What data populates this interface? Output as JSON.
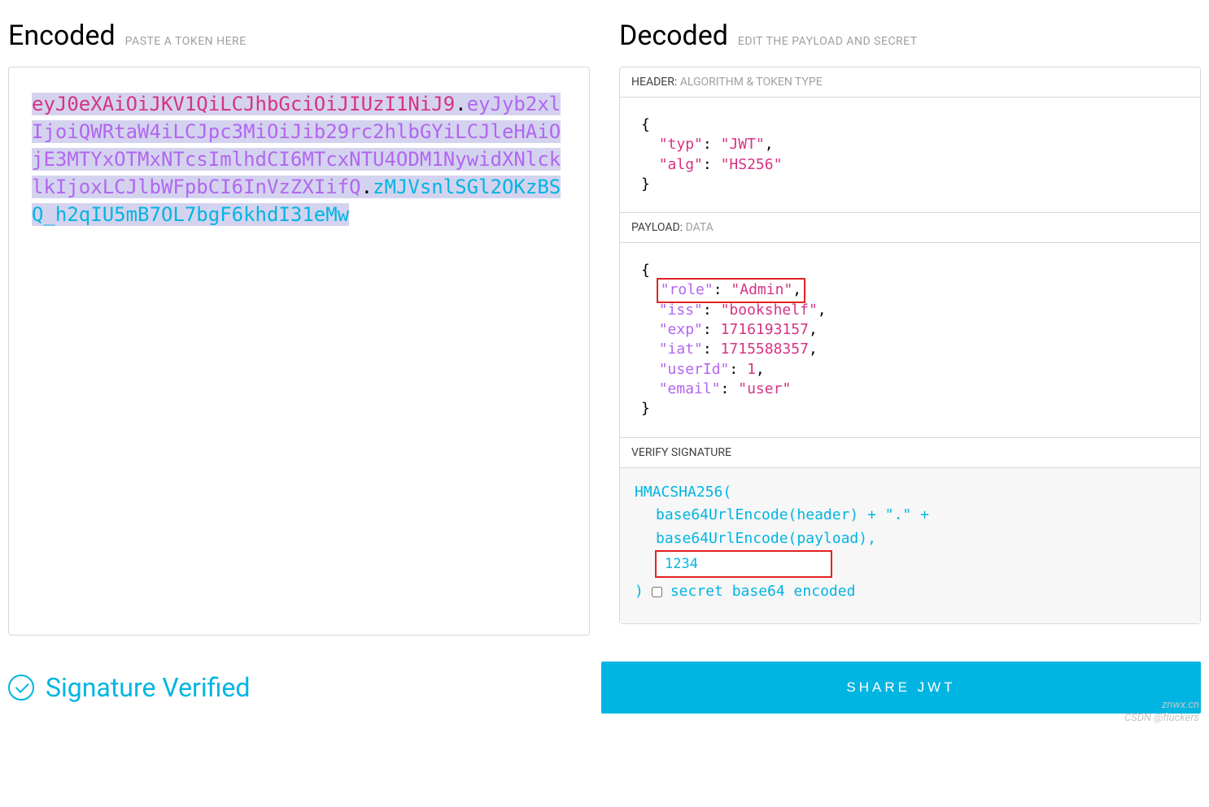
{
  "encoded": {
    "title": "Encoded",
    "hint": "PASTE A TOKEN HERE",
    "header": "eyJ0eXAiOiJKV1QiLCJhbGciOiJIUzI1NiJ9",
    "payload": "eyJyb2xlIjoiQWRtaW4iLCJpc3MiOiJib29rc2hlbGYiLCJleHAiOjE3MTYxOTMxNTcsImlhdCI6MTcxNTU4ODM1NywidXNlcklkIjoxLCJlbWFpbCI6InVzZXIifQ",
    "signature": "zMJVsnlSGl2OKzBSQ_h2qIU5mB7OL7bgF6khdI31eMw"
  },
  "decoded": {
    "title": "Decoded",
    "hint": "EDIT THE PAYLOAD AND SECRET",
    "header_section": {
      "label": "HEADER:",
      "sub": "ALGORITHM & TOKEN TYPE"
    },
    "header_json": {
      "typ": "JWT",
      "alg": "HS256"
    },
    "payload_section": {
      "label": "PAYLOAD:",
      "sub": "DATA"
    },
    "payload_json": {
      "role": "Admin",
      "iss": "bookshelf",
      "exp": 1716193157,
      "iat": 1715588357,
      "userId": 1,
      "email": "user"
    },
    "verify_section": {
      "label": "VERIFY SIGNATURE"
    },
    "signature": {
      "fn": "HMACSHA256(",
      "line1": "base64UrlEncode(header) + \".\" +",
      "line2": "base64UrlEncode(payload),",
      "secret_value": "1234",
      "close": ")",
      "checkbox_label": "secret base64 encoded"
    }
  },
  "footer": {
    "verified_text": "Signature Verified",
    "share_button": "SHARE JWT"
  },
  "watermark": {
    "line1": "znwx.cn",
    "line2": "CSDN @fluckers"
  }
}
